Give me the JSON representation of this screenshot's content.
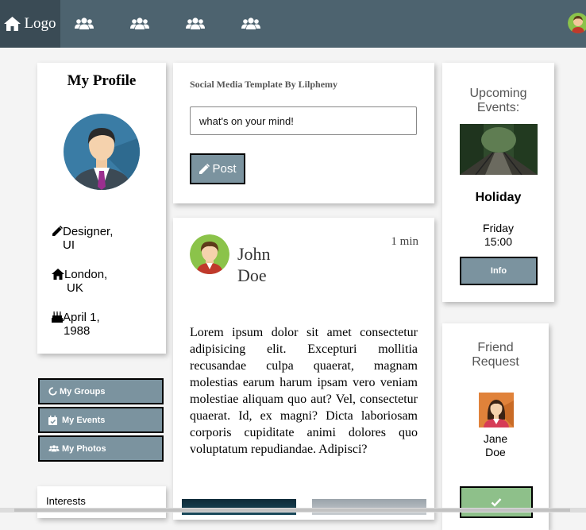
{
  "nav": {
    "logo_label": "Logo",
    "home_icon": "home-icon",
    "group_icons": [
      "users-icon",
      "users-icon",
      "users-icon",
      "users-icon"
    ]
  },
  "profile": {
    "title": "My Profile",
    "job_line1": "Designer,",
    "job_line2": "UI",
    "location_line1": "London,",
    "location_line2": "UK",
    "birthday_line1": "April 1,",
    "birthday_line2": "1988"
  },
  "menu": {
    "groups": "My Groups",
    "events": "My Events",
    "photos": "My Photos"
  },
  "interests": {
    "title": "Interests"
  },
  "composer": {
    "heading": "Social Media Template By Lilphemy",
    "input_value": "what's on your mind!",
    "post_label": "Post"
  },
  "post": {
    "author_first": "John",
    "author_last": "Doe",
    "time": "1 min",
    "body": "Lorem ipsum dolor sit amet consectetur adipisicing elit. Excepturi mollitia recusandae culpa quaerat, magnam molestias earum harum ipsam vero veniam molestiae aliquam quo aut? Vel, consectetur quaerat. Id, ex magni? Dicta laboriosam corporis cupiditate animi dolores quo voluptatum repudiandae. Adipisci?"
  },
  "events": {
    "title_line1": "Upcoming",
    "title_line2": "Events:",
    "event_name": "Holiday",
    "day": "Friday",
    "time": "15:00",
    "info_label": "Info"
  },
  "friend_request": {
    "title_line1": "Friend",
    "title_line2": "Request",
    "first_name": "Jane",
    "last_name": "Doe",
    "accept_icon": "check-icon"
  },
  "colors": {
    "nav_bg": "#4d636f",
    "logo_bg": "#3a4b55",
    "button_bg": "#7b939f",
    "accept_bg": "#8ec08a"
  }
}
